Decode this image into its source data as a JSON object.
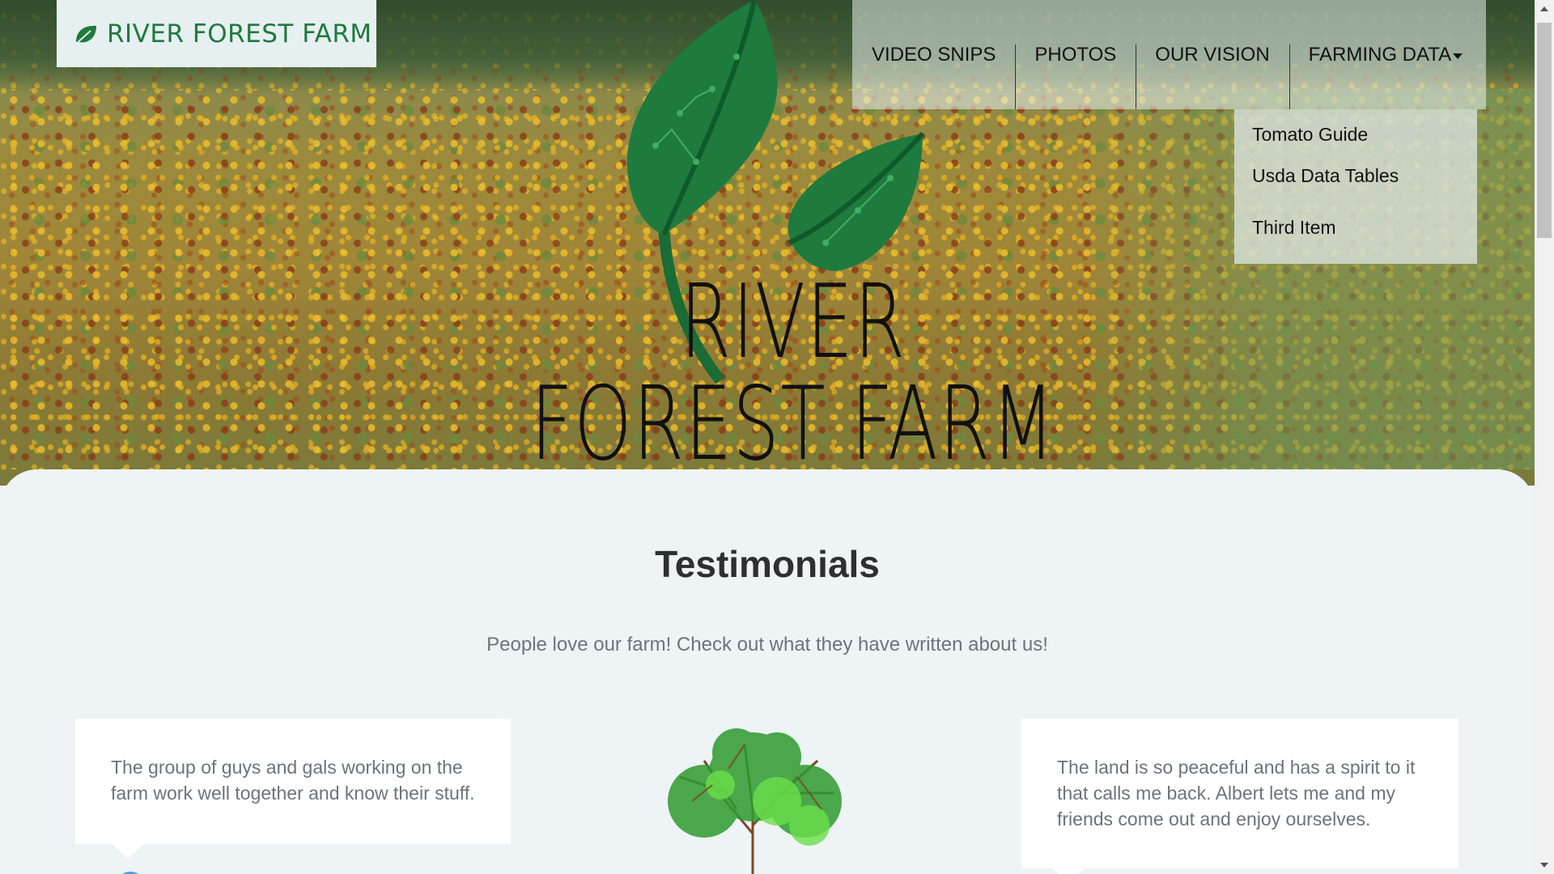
{
  "brand": {
    "name": "RIVER FOREST FARM",
    "icon": "leaf-icon"
  },
  "hero": {
    "logo_text": "RIVER FOREST FARM"
  },
  "nav": {
    "items": [
      {
        "label": "VIDEO SNIPS"
      },
      {
        "label": "PHOTOS"
      },
      {
        "label": "OUR VISION"
      },
      {
        "label": "FARMING DATA"
      }
    ],
    "dropdown": [
      {
        "label": "Tomato Guide"
      },
      {
        "label": "Usda Data Tables"
      },
      {
        "label": "Third Item"
      }
    ]
  },
  "testimonials": {
    "title": "Testimonials",
    "subtitle": "People love our farm! Check out what they have written about us!",
    "cards": [
      {
        "text": "The group of guys and gals working on the farm work well together and know their stuff."
      },
      {
        "text": "The land is so peaceful and has a spirit to it that calls me back. Albert lets me and my friends come out and enjoy ourselves."
      }
    ]
  },
  "colors": {
    "brand_green": "#1e7a3f",
    "page_bg": "#eef3f6",
    "text_gray": "#6d737a"
  }
}
